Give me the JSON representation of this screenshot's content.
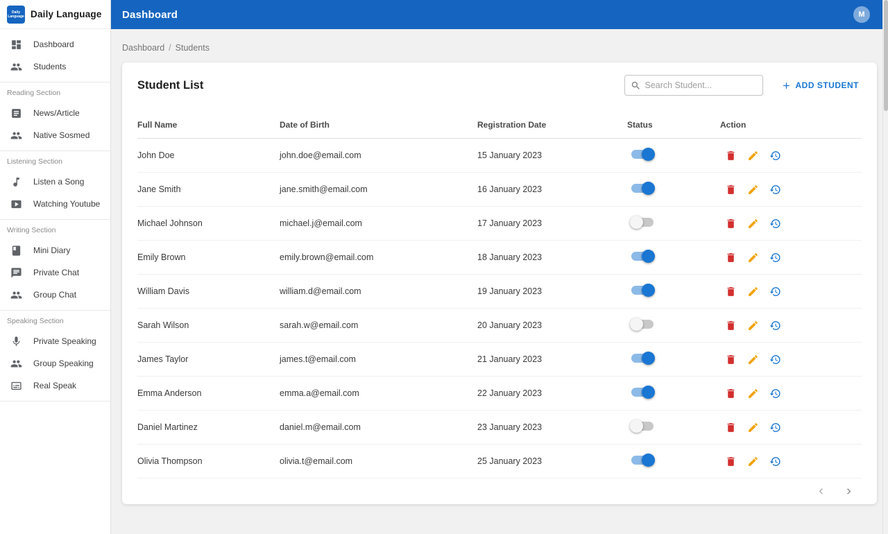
{
  "app": {
    "brand": "Daily Language",
    "logo_text": "Daily Language"
  },
  "topbar": {
    "title": "Dashboard",
    "avatar_initial": "M"
  },
  "sidebar": {
    "top": [
      {
        "label": "Dashboard"
      },
      {
        "label": "Students"
      }
    ],
    "sections": [
      {
        "title": "Reading Section",
        "items": [
          {
            "label": "News/Article"
          },
          {
            "label": "Native Sosmed"
          }
        ]
      },
      {
        "title": "Listening Section",
        "items": [
          {
            "label": "Listen a Song"
          },
          {
            "label": "Watching Youtube"
          }
        ]
      },
      {
        "title": "Writing Section",
        "items": [
          {
            "label": "Mini Diary"
          },
          {
            "label": "Private Chat"
          },
          {
            "label": "Group Chat"
          }
        ]
      },
      {
        "title": "Speaking Section",
        "items": [
          {
            "label": "Private Speaking"
          },
          {
            "label": "Group Speaking"
          },
          {
            "label": "Real Speak"
          }
        ]
      }
    ]
  },
  "breadcrumb": {
    "items": [
      "Dashboard",
      "Students"
    ],
    "separator": "/"
  },
  "main": {
    "title": "Student List",
    "search_placeholder": "Search Student...",
    "add_button_label": "ADD STUDENT"
  },
  "table": {
    "headers": [
      "Full Name",
      "Date of Birth",
      "Registration Date",
      "Status",
      "Action"
    ],
    "rows": [
      {
        "name": "John Doe",
        "email": "john.doe@email.com",
        "registered": "15 January 2023",
        "active": true
      },
      {
        "name": "Jane Smith",
        "email": "jane.smith@email.com",
        "registered": "16 January 2023",
        "active": true
      },
      {
        "name": "Michael Johnson",
        "email": "michael.j@email.com",
        "registered": "17 January 2023",
        "active": false
      },
      {
        "name": "Emily Brown",
        "email": "emily.brown@email.com",
        "registered": "18 January 2023",
        "active": true
      },
      {
        "name": "William Davis",
        "email": "william.d@email.com",
        "registered": "19 January 2023",
        "active": true
      },
      {
        "name": "Sarah Wilson",
        "email": "sarah.w@email.com",
        "registered": "20 January 2023",
        "active": false
      },
      {
        "name": "James Taylor",
        "email": "james.t@email.com",
        "registered": "21 January 2023",
        "active": true
      },
      {
        "name": "Emma Anderson",
        "email": "emma.a@email.com",
        "registered": "22 January 2023",
        "active": true
      },
      {
        "name": "Daniel Martinez",
        "email": "daniel.m@email.com",
        "registered": "23 January 2023",
        "active": false
      },
      {
        "name": "Olivia Thompson",
        "email": "olivia.t@email.com",
        "registered": "25 January 2023",
        "active": true
      }
    ]
  },
  "colors": {
    "topbar": "#1565c0",
    "accent": "#1976d2",
    "delete": "#d32f2f",
    "edit": "#f0a30a",
    "toggle_on": "#1976d2"
  }
}
